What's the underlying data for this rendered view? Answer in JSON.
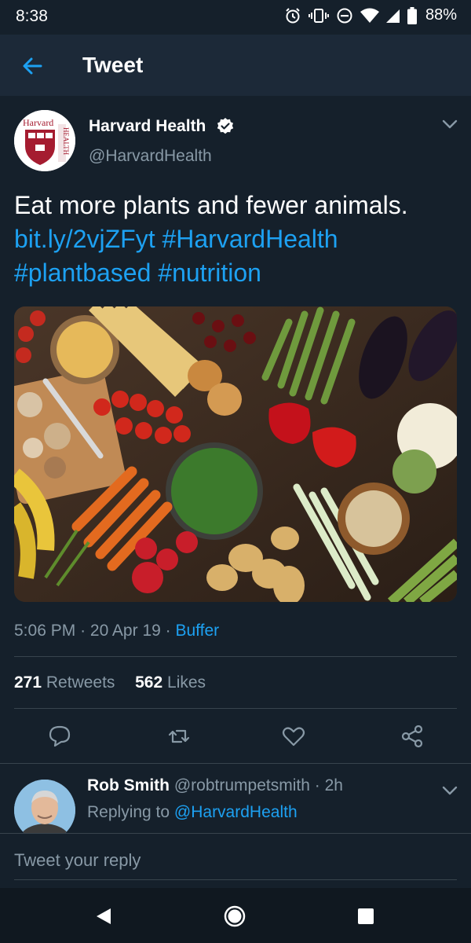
{
  "status_bar": {
    "time": "8:38",
    "battery": "88%",
    "icons": [
      "alarm-icon",
      "vibrate-icon",
      "dnd-icon",
      "wifi-icon",
      "signal-icon",
      "battery-icon"
    ]
  },
  "header": {
    "title": "Tweet",
    "back_icon": "back-arrow-icon"
  },
  "tweet": {
    "author_name": "Harvard Health",
    "author_handle": "@HarvardHealth",
    "verified": true,
    "avatar_text": "Harvard",
    "avatar_side_text": "HEALTH",
    "text": "Eat more plants and fewer animals.",
    "link": "bit.ly/2vjZFyt",
    "hashtags": [
      "#HarvardHealth",
      "#plantbased",
      "#nutrition"
    ],
    "time": "5:06 PM",
    "date": "20 Apr 19",
    "source": "Buffer",
    "retweets_count": "271",
    "retweets_label": "Retweets",
    "likes_count": "562",
    "likes_label": "Likes"
  },
  "actions": [
    "reply-icon",
    "retweet-icon",
    "like-icon",
    "share-icon"
  ],
  "reply": {
    "name": "Rob Smith",
    "handle": "@robtrumpetsmith",
    "time": "2h",
    "replying_prefix": "Replying to",
    "replying_to": "@HarvardHealth"
  },
  "reply_box": {
    "placeholder": "Tweet your reply"
  },
  "nav": [
    "back-triangle-icon",
    "home-circle-icon",
    "recents-square-icon"
  ],
  "colors": {
    "background": "#15202b",
    "header": "#1c2938",
    "accent": "#1da1f2",
    "secondary_text": "#8899a6",
    "divider": "#38444d"
  }
}
